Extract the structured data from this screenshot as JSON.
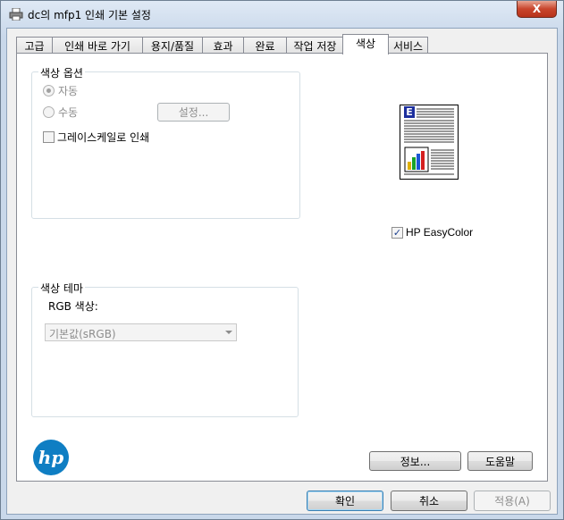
{
  "window": {
    "title": "dc의 mfp1 인쇄 기본 설정",
    "close_glyph": "X"
  },
  "tabs": [
    {
      "label": "고급"
    },
    {
      "label": "인쇄 바로 가기"
    },
    {
      "label": "용지/품질"
    },
    {
      "label": "효과"
    },
    {
      "label": "완료"
    },
    {
      "label": "작업 저장"
    },
    {
      "label": "색상",
      "active": true
    },
    {
      "label": "서비스"
    }
  ],
  "color_options": {
    "title": "색상 옵션",
    "auto_label": "자동",
    "manual_label": "수동",
    "settings_button": "설정...",
    "grayscale_label": "그레이스케일로 인쇄",
    "selected": "auto"
  },
  "preview": {
    "letter": "E"
  },
  "easycolor": {
    "label": "HP EasyColor",
    "checked": true,
    "check_glyph": "✓"
  },
  "color_theme": {
    "title": "색상 테마",
    "rgb_label": "RGB 색상:",
    "rgb_value": "기본값(sRGB)"
  },
  "logo": {
    "text": "hp"
  },
  "panel_buttons": {
    "about": "정보...",
    "help": "도움말"
  },
  "footer": {
    "ok": "확인",
    "cancel": "취소",
    "apply": "적용(A)"
  },
  "colors": {
    "logo_blue": "#0f7ec3",
    "accent": "#1b3f8f"
  }
}
